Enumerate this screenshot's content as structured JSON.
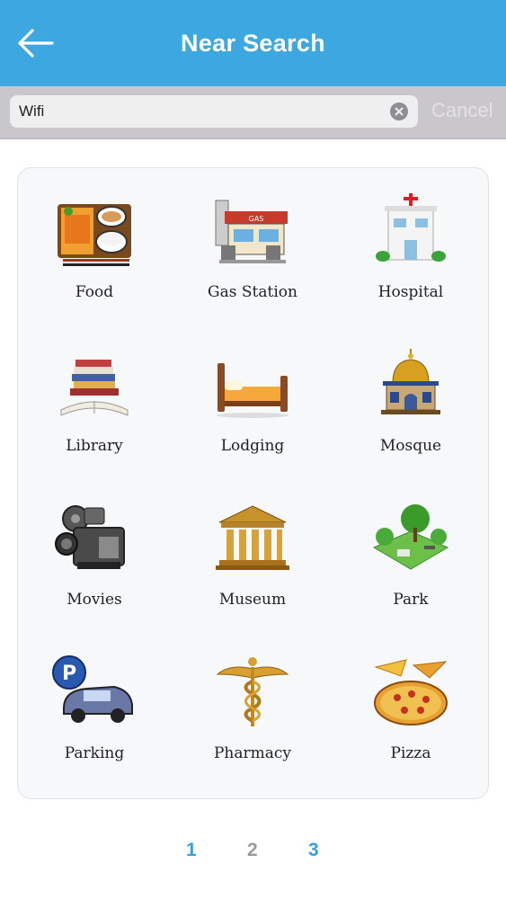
{
  "header": {
    "title": "Near Search"
  },
  "search": {
    "value": "Wifi",
    "cancel_label": "Cancel"
  },
  "categories": [
    {
      "label": "Food",
      "icon": "food-icon"
    },
    {
      "label": "Gas Station",
      "icon": "gas-station-icon"
    },
    {
      "label": "Hospital",
      "icon": "hospital-icon"
    },
    {
      "label": "Library",
      "icon": "library-icon"
    },
    {
      "label": "Lodging",
      "icon": "bed-icon"
    },
    {
      "label": "Mosque",
      "icon": "mosque-icon"
    },
    {
      "label": "Movies",
      "icon": "movie-camera-icon"
    },
    {
      "label": "Museum",
      "icon": "museum-icon"
    },
    {
      "label": "Park",
      "icon": "park-icon"
    },
    {
      "label": "Parking",
      "icon": "parking-car-icon"
    },
    {
      "label": "Pharmacy",
      "icon": "caduceus-icon"
    },
    {
      "label": "Pizza",
      "icon": "pizza-icon"
    }
  ],
  "pagination": {
    "pages": [
      "1",
      "2",
      "3"
    ],
    "current": "2"
  },
  "colors": {
    "header": "#3da8e0",
    "page_active": "#3a9fd8",
    "page_current": "#9a9a9a"
  }
}
